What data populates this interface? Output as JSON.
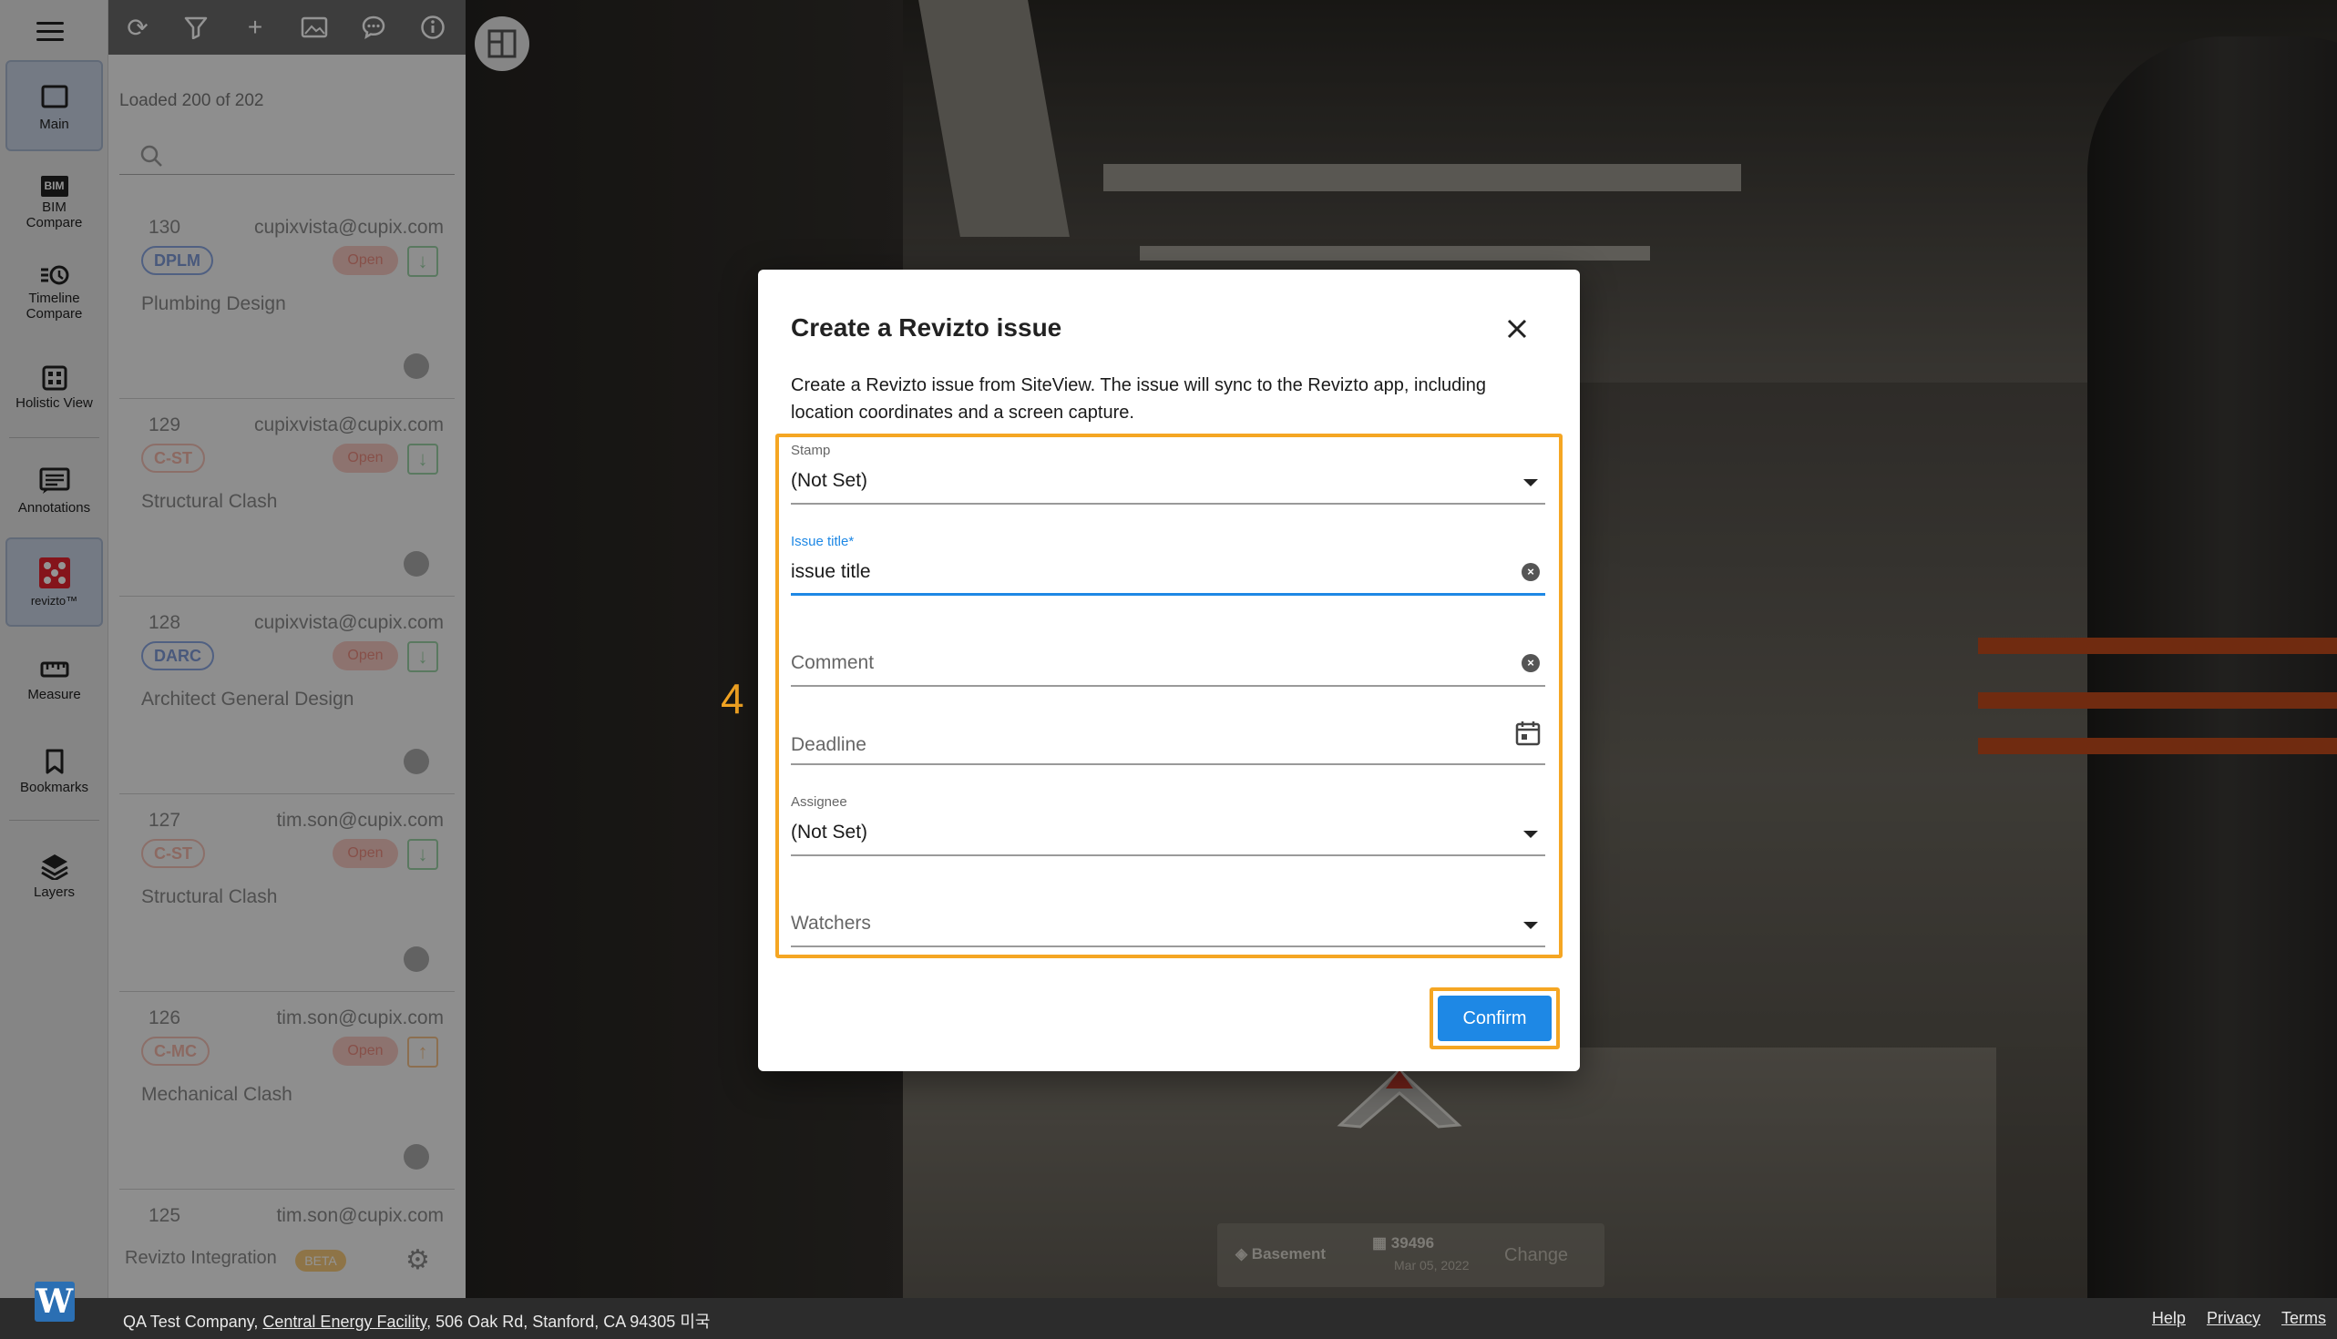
{
  "rail": {
    "items": [
      {
        "label": "Main"
      },
      {
        "label": "BIM Compare",
        "badge": "BIM"
      },
      {
        "label": "Timeline Compare"
      },
      {
        "label": "Holistic View"
      },
      {
        "label": "Annotations"
      },
      {
        "label": "revizto™"
      },
      {
        "label": "Measure"
      },
      {
        "label": "Bookmarks"
      },
      {
        "label": "Layers"
      }
    ],
    "logo": "W"
  },
  "panel": {
    "loaded_text": "Loaded 200 of 202",
    "issues": [
      {
        "num": "130",
        "email": "cupixvista@cupix.com",
        "stamp": "DPLM",
        "status": "Open",
        "title": "Plumbing Design"
      },
      {
        "num": "129",
        "email": "cupixvista@cupix.com",
        "stamp": "C-ST",
        "status": "Open",
        "title": "Structural Clash"
      },
      {
        "num": "128",
        "email": "cupixvista@cupix.com",
        "stamp": "DARC",
        "status": "Open",
        "title": "Architect General Design"
      },
      {
        "num": "127",
        "email": "tim.son@cupix.com",
        "stamp": "C-ST",
        "status": "Open",
        "title": "Structural Clash"
      },
      {
        "num": "126",
        "email": "tim.son@cupix.com",
        "stamp": "C-MC",
        "status": "Open",
        "title": "Mechanical Clash"
      },
      {
        "num": "125",
        "email": "tim.son@cupix.com",
        "stamp": "",
        "status": "",
        "title": ""
      }
    ],
    "footer_label": "Revizto Integration",
    "footer_badge": "BETA"
  },
  "viewer": {
    "floor": "Basement",
    "capture_id": "39496",
    "capture_date": "Mar 05, 2022",
    "change_label": "Change"
  },
  "dialog": {
    "title": "Create a Revizto issue",
    "description": "Create a Revizto issue from SiteView. The issue will sync to the Revizto app, including location coordinates and a screen capture.",
    "stamp": {
      "label": "Stamp",
      "value": "(Not Set)"
    },
    "issue_title": {
      "label": "Issue title*",
      "value": "issue title"
    },
    "comment": {
      "placeholder": "Comment"
    },
    "deadline": {
      "placeholder": "Deadline"
    },
    "assignee": {
      "label": "Assignee",
      "value": "(Not Set)"
    },
    "watchers": {
      "placeholder": "Watchers"
    },
    "confirm_label": "Confirm"
  },
  "annotation": {
    "step_number": "4",
    "color": "#f5a623"
  },
  "statusbar": {
    "company": "QA Test Company, ",
    "project": "Central Energy Facility",
    "address": ", 506 Oak Rd, Stanford, CA 94305 미국",
    "links": [
      "Help",
      "Privacy",
      "Terms"
    ]
  },
  "colors": {
    "accent": "#1e88e5",
    "highlight": "#f5a623"
  }
}
